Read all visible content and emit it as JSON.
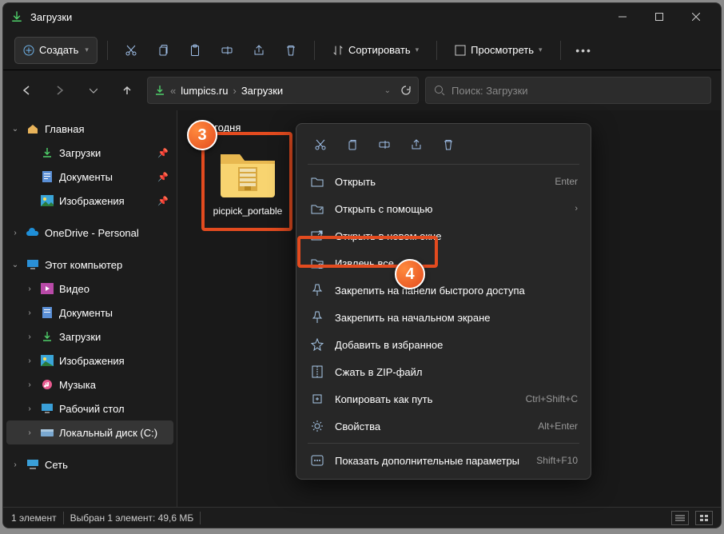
{
  "titlebar": {
    "title": "Загрузки"
  },
  "toolbar": {
    "create": "Создать",
    "sort": "Сортировать",
    "view": "Просмотреть"
  },
  "breadcrumb": {
    "root": "lumpics.ru",
    "current": "Загрузки"
  },
  "search": {
    "placeholder": "Поиск: Загрузки"
  },
  "sidebar": {
    "home": "Главная",
    "downloads": "Загрузки",
    "documents": "Документы",
    "pictures": "Изображения",
    "onedrive": "OneDrive - Personal",
    "thispc": "Этот компьютер",
    "video": "Видео",
    "documents2": "Документы",
    "downloads2": "Загрузки",
    "pictures2": "Изображения",
    "music": "Музыка",
    "desktop": "Рабочий стол",
    "localdisk": "Локальный диск (C:)",
    "network": "Сеть"
  },
  "content": {
    "group": "Сегодня",
    "file": "picpick_portable"
  },
  "ctx": {
    "open": "Открыть",
    "open_kbd": "Enter",
    "openwith": "Открыть с помощью",
    "newwindow": "Открыть в новом окне",
    "extract": "Извлечь все...",
    "pinquick": "Закрепить на панели быстрого доступа",
    "pinstart": "Закрепить на начальном экране",
    "favorite": "Добавить в избранное",
    "zip": "Сжать в ZIP-файл",
    "copypath": "Копировать как путь",
    "copypath_kbd": "Ctrl+Shift+C",
    "props": "Свойства",
    "props_kbd": "Alt+Enter",
    "more": "Показать дополнительные параметры",
    "more_kbd": "Shift+F10"
  },
  "status": {
    "count": "1 элемент",
    "selected": "Выбран 1 элемент: 49,6 МБ"
  },
  "badges": {
    "b3": "3",
    "b4": "4"
  }
}
